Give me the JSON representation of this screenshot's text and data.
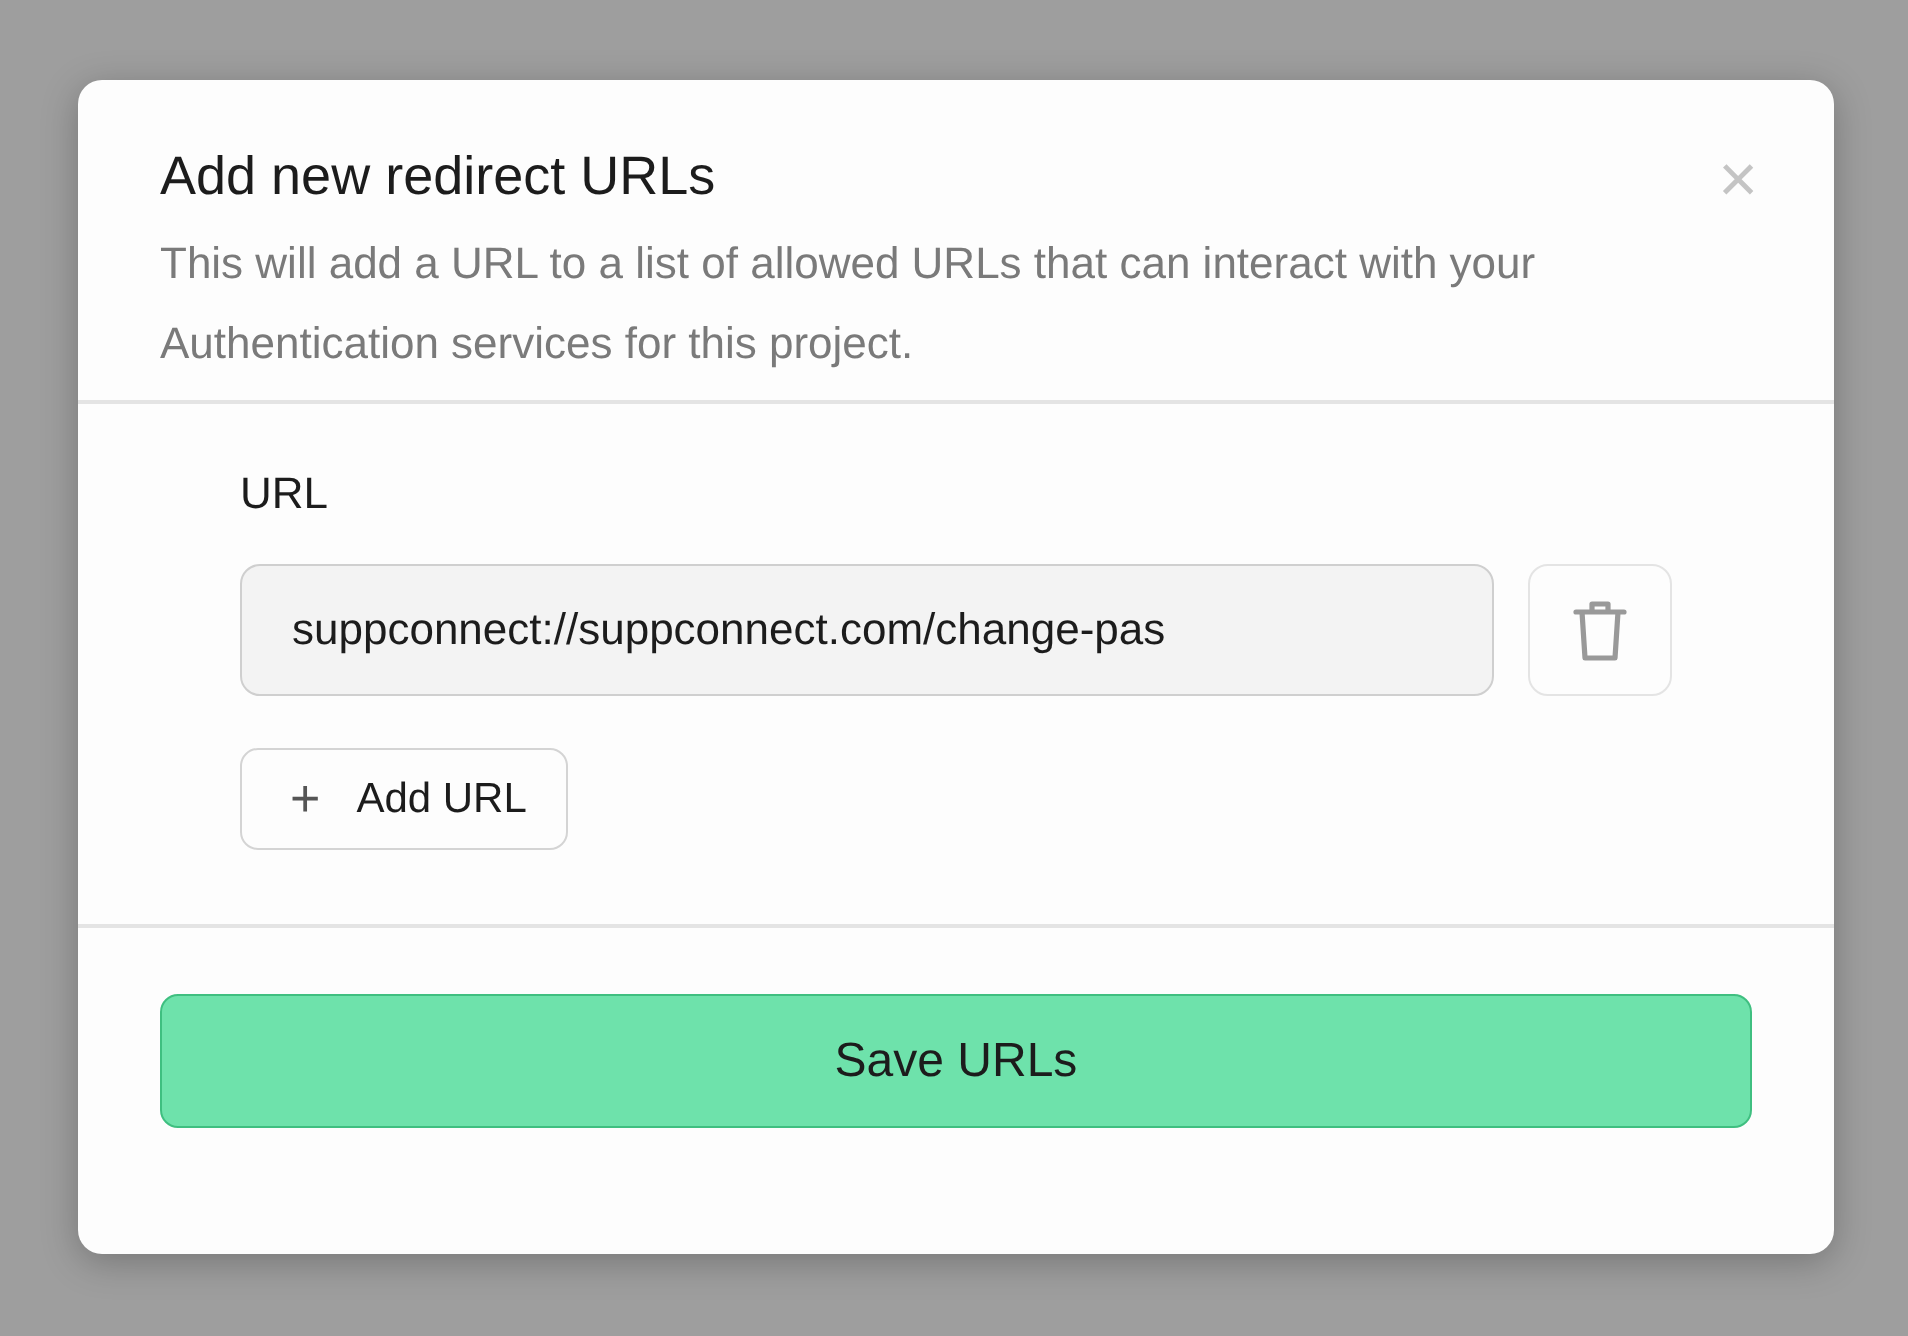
{
  "dialog": {
    "title": "Add new redirect URLs",
    "description": "This will add a URL to a list of allowed URLs that can interact with your Authentication services for this project.",
    "close_icon": "×",
    "url_label": "URL",
    "urls": [
      {
        "value": "suppconnect://suppconnect.com/change-pas"
      }
    ],
    "add_button": {
      "icon": "+",
      "label": "Add URL"
    },
    "save_button": "Save URLs"
  }
}
